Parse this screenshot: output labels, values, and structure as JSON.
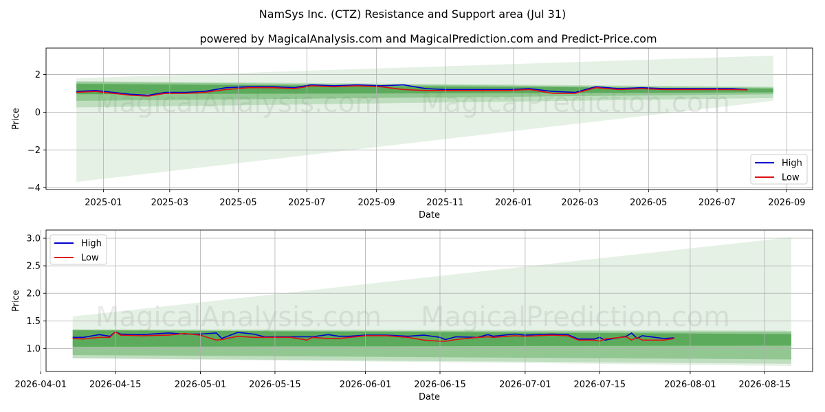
{
  "title": "NamSys Inc. (CTZ) Resistance and Support area (Jul 31)",
  "subtitle": "powered by MagicalAnalysis.com and MagicalPrediction.com and Predict-Price.com",
  "watermark": [
    "MagicalAnalysis.com",
    "MagicalPrediction.com"
  ],
  "colors": {
    "high": "#0000cc",
    "low": "#dd1111",
    "band_dark": "#3a9a3a",
    "band_light": "#b9dcb9",
    "grid": "#b0b0b0"
  },
  "chart_data": [
    {
      "type": "line",
      "xlabel": "Date",
      "ylabel": "Price",
      "x_ticks": [
        "2025-01",
        "2025-03",
        "2025-05",
        "2025-07",
        "2025-09",
        "2025-11",
        "2026-01",
        "2026-03",
        "2026-05",
        "2026-07",
        "2026-09"
      ],
      "y_ticks": [
        "−4",
        "−2",
        "0",
        "2"
      ],
      "ylim": [
        -4.1,
        3.4
      ],
      "grid": true,
      "legend": {
        "position": "lower-right",
        "entries": [
          "High",
          "Low"
        ]
      },
      "series": [
        {
          "name": "High",
          "x": [
            "2024-12-08",
            "2024-12-25",
            "2025-01-10",
            "2025-01-25",
            "2025-02-10",
            "2025-02-25",
            "2025-03-15",
            "2025-04-01",
            "2025-04-20",
            "2025-05-10",
            "2025-06-01",
            "2025-06-20",
            "2025-07-05",
            "2025-07-25",
            "2025-08-15",
            "2025-09-05",
            "2025-09-25",
            "2025-10-15",
            "2025-11-01",
            "2025-11-20",
            "2025-12-10",
            "2025-12-28",
            "2026-01-15",
            "2026-02-05",
            "2026-02-25",
            "2026-03-15",
            "2026-04-05",
            "2026-04-25",
            "2026-05-15",
            "2026-06-05",
            "2026-06-25",
            "2026-07-15",
            "2026-07-28"
          ],
          "values": [
            1.1,
            1.15,
            1.05,
            0.95,
            0.9,
            1.05,
            1.05,
            1.1,
            1.3,
            1.35,
            1.35,
            1.3,
            1.45,
            1.4,
            1.45,
            1.4,
            1.45,
            1.25,
            1.2,
            1.2,
            1.2,
            1.2,
            1.25,
            1.1,
            1.05,
            1.35,
            1.25,
            1.3,
            1.25,
            1.25,
            1.25,
            1.25,
            1.2
          ]
        },
        {
          "name": "Low",
          "x": [
            "2024-12-08",
            "2024-12-25",
            "2025-01-10",
            "2025-01-25",
            "2025-02-10",
            "2025-02-25",
            "2025-03-15",
            "2025-04-01",
            "2025-04-20",
            "2025-05-10",
            "2025-06-01",
            "2025-06-20",
            "2025-07-05",
            "2025-07-25",
            "2025-08-15",
            "2025-09-05",
            "2025-09-25",
            "2025-10-15",
            "2025-11-01",
            "2025-11-20",
            "2025-12-10",
            "2025-12-28",
            "2026-01-15",
            "2026-02-05",
            "2026-02-25",
            "2026-03-15",
            "2026-04-05",
            "2026-04-25",
            "2026-05-15",
            "2026-06-05",
            "2026-06-25",
            "2026-07-15",
            "2026-07-28"
          ],
          "values": [
            1.05,
            1.1,
            1.0,
            0.9,
            0.85,
            1.0,
            1.0,
            1.05,
            1.2,
            1.3,
            1.3,
            1.25,
            1.4,
            1.35,
            1.4,
            1.35,
            1.2,
            1.15,
            1.15,
            1.15,
            1.15,
            1.15,
            1.2,
            1.0,
            1.0,
            1.3,
            1.2,
            1.25,
            1.2,
            1.2,
            1.2,
            1.2,
            1.18
          ]
        }
      ],
      "bands": [
        {
          "x": [
            "2024-12-08",
            "2026-08-20"
          ],
          "upper": [
            1.8,
            3.0
          ],
          "lower": [
            -3.7,
            0.6
          ],
          "shade": "lightest"
        },
        {
          "x": [
            "2024-12-08",
            "2026-08-20"
          ],
          "upper": [
            1.65,
            1.35
          ],
          "lower": [
            0.25,
            0.75
          ],
          "shade": "light"
        },
        {
          "x": [
            "2024-12-08",
            "2026-08-20"
          ],
          "upper": [
            1.6,
            1.3
          ],
          "lower": [
            0.6,
            0.95
          ],
          "shade": "medium"
        },
        {
          "x": [
            "2024-12-08",
            "2026-08-20"
          ],
          "upper": [
            1.5,
            1.25
          ],
          "lower": [
            0.95,
            1.05
          ],
          "shade": "dark"
        }
      ]
    },
    {
      "type": "line",
      "xlabel": "Date",
      "ylabel": "Price",
      "x_ticks": [
        "2026-04-01",
        "2026-04-15",
        "2026-05-01",
        "2026-05-15",
        "2026-06-01",
        "2026-06-15",
        "2026-07-01",
        "2026-07-15",
        "2026-08-01",
        "2026-08-15"
      ],
      "y_ticks": [
        "1.0",
        "1.5",
        "2.0",
        "2.5",
        "3.0"
      ],
      "ylim": [
        0.58,
        3.15
      ],
      "grid": true,
      "legend": {
        "position": "upper-left",
        "entries": [
          "High",
          "Low"
        ]
      },
      "series": [
        {
          "name": "High",
          "x": [
            "2026-04-07",
            "2026-04-09",
            "2026-04-12",
            "2026-04-14",
            "2026-04-15",
            "2026-04-16",
            "2026-04-20",
            "2026-04-25",
            "2026-04-28",
            "2026-05-01",
            "2026-05-04",
            "2026-05-05",
            "2026-05-08",
            "2026-05-11",
            "2026-05-13",
            "2026-05-18",
            "2026-05-21",
            "2026-05-22",
            "2026-05-25",
            "2026-05-27",
            "2026-05-29",
            "2026-06-01",
            "2026-06-05",
            "2026-06-09",
            "2026-06-12",
            "2026-06-15",
            "2026-06-16",
            "2026-06-18",
            "2026-06-22",
            "2026-06-24",
            "2026-06-25",
            "2026-06-29",
            "2026-07-01",
            "2026-07-06",
            "2026-07-09",
            "2026-07-11",
            "2026-07-14",
            "2026-07-15",
            "2026-07-16",
            "2026-07-20",
            "2026-07-21",
            "2026-07-22",
            "2026-07-23",
            "2026-07-27",
            "2026-07-29"
          ],
          "values": [
            1.2,
            1.2,
            1.25,
            1.22,
            1.3,
            1.26,
            1.25,
            1.28,
            1.26,
            1.26,
            1.28,
            1.18,
            1.29,
            1.26,
            1.21,
            1.21,
            1.21,
            1.21,
            1.25,
            1.22,
            1.22,
            1.24,
            1.24,
            1.22,
            1.24,
            1.2,
            1.16,
            1.21,
            1.2,
            1.25,
            1.22,
            1.26,
            1.24,
            1.26,
            1.25,
            1.17,
            1.17,
            1.2,
            1.15,
            1.22,
            1.28,
            1.18,
            1.23,
            1.18,
            1.19
          ]
        },
        {
          "name": "Low",
          "x": [
            "2026-04-07",
            "2026-04-09",
            "2026-04-12",
            "2026-04-14",
            "2026-04-15",
            "2026-04-16",
            "2026-04-20",
            "2026-04-25",
            "2026-04-28",
            "2026-05-01",
            "2026-05-04",
            "2026-05-05",
            "2026-05-08",
            "2026-05-11",
            "2026-05-13",
            "2026-05-18",
            "2026-05-21",
            "2026-05-22",
            "2026-05-25",
            "2026-05-27",
            "2026-05-29",
            "2026-06-01",
            "2026-06-05",
            "2026-06-09",
            "2026-06-12",
            "2026-06-15",
            "2026-06-16",
            "2026-06-18",
            "2026-06-22",
            "2026-06-24",
            "2026-06-25",
            "2026-06-29",
            "2026-07-01",
            "2026-07-06",
            "2026-07-09",
            "2026-07-11",
            "2026-07-14",
            "2026-07-15",
            "2026-07-16",
            "2026-07-20",
            "2026-07-21",
            "2026-07-22",
            "2026-07-23",
            "2026-07-27",
            "2026-07-29"
          ],
          "values": [
            1.18,
            1.17,
            1.2,
            1.2,
            1.3,
            1.24,
            1.23,
            1.24,
            1.27,
            1.24,
            1.15,
            1.16,
            1.22,
            1.2,
            1.2,
            1.2,
            1.15,
            1.2,
            1.18,
            1.18,
            1.2,
            1.23,
            1.23,
            1.2,
            1.15,
            1.13,
            1.13,
            1.16,
            1.2,
            1.21,
            1.2,
            1.23,
            1.22,
            1.24,
            1.23,
            1.15,
            1.15,
            1.13,
            1.17,
            1.21,
            1.15,
            1.2,
            1.15,
            1.15,
            1.18
          ]
        }
      ],
      "bands": [
        {
          "x": [
            "2026-04-07",
            "2026-08-20"
          ],
          "upper": [
            1.58,
            3.02
          ],
          "lower": [
            0.82,
            0.68
          ],
          "shade": "lightest"
        },
        {
          "x": [
            "2026-04-07",
            "2026-08-20"
          ],
          "upper": [
            1.35,
            1.32
          ],
          "lower": [
            0.82,
            0.72
          ],
          "shade": "light"
        },
        {
          "x": [
            "2026-04-07",
            "2026-08-20"
          ],
          "upper": [
            1.33,
            1.3
          ],
          "lower": [
            0.88,
            0.8
          ],
          "shade": "medium"
        },
        {
          "x": [
            "2026-04-07",
            "2026-08-20"
          ],
          "upper": [
            1.33,
            1.26
          ],
          "lower": [
            1.03,
            1.05
          ],
          "shade": "dark"
        }
      ]
    }
  ]
}
